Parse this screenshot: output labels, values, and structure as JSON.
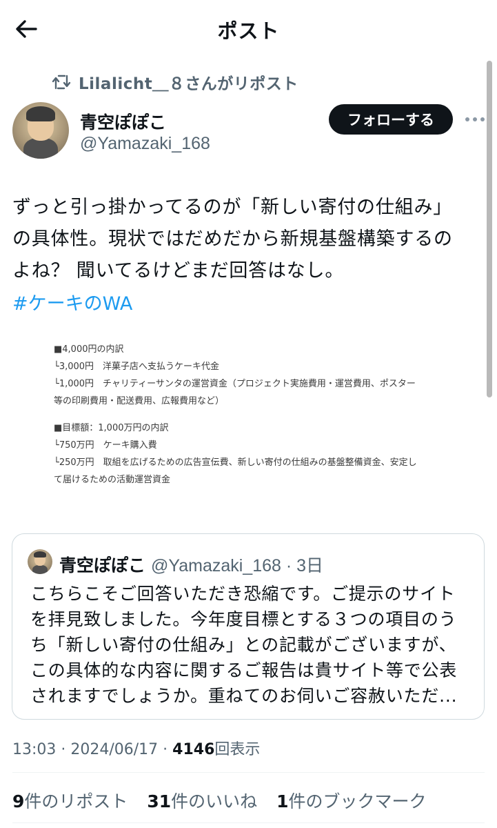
{
  "header": {
    "title": "ポスト"
  },
  "repost": {
    "text": "Lilalicht＿８さんがリポスト"
  },
  "author": {
    "name": "青空ぽぽこ",
    "handle": "@Yamazaki_168"
  },
  "follow_button": "フォローする",
  "tweet": {
    "text": "ずっと引っ掛かってるのが「新しい寄付の仕組み」\nの具体性。現状ではだめだから新規基盤構築するの\nよね？ 聞いてるけどまだ回答はなし。",
    "hashtag": "#ケーキのWA"
  },
  "attachment": {
    "lines1": [
      "■4,000円の内訳",
      "└3,000円　洋菓子店へ支払うケーキ代金",
      "└1,000円　チャリティーサンタの運営資金（プロジェクト実施費用・運営費用、ポスター",
      "等の印刷費用・配送費用、広報費用など）"
    ],
    "lines2": [
      "■目標額：1,000万円の内訳",
      "└750万円　ケーキ購入費",
      "└250万円　取組を広げるための広告宣伝費、新しい寄付の仕組みの基盤整備資金、安定し",
      "て届けるための活動運営資金"
    ]
  },
  "quote": {
    "name": "青空ぽぽこ",
    "handle": "@Yamazaki_168 · 3日",
    "text": "こちらこそご回答いただき恐縮です。ご提示のサイト\nを拝見致しました。今年度目標とする３つの項目のう\nち「新しい寄付の仕組み」との記載がございますが、\nこの具体的な内容に関するご報告は貴サイト等で公表\nされますでしょうか。重ねてのお伺いご容赦いただ..."
  },
  "meta": {
    "time": "13:03 · 2024/06/17 · ",
    "views_count": "4146",
    "views_label": "回表示"
  },
  "stats": {
    "reposts_count": "9",
    "reposts_label": "件のリポスト",
    "likes_count": "31",
    "likes_label": "件のいいね",
    "bookmarks_count": "1",
    "bookmarks_label": "件のブックマーク"
  },
  "icons": [
    "back-arrow-icon",
    "repost-icon",
    "more-icon"
  ]
}
